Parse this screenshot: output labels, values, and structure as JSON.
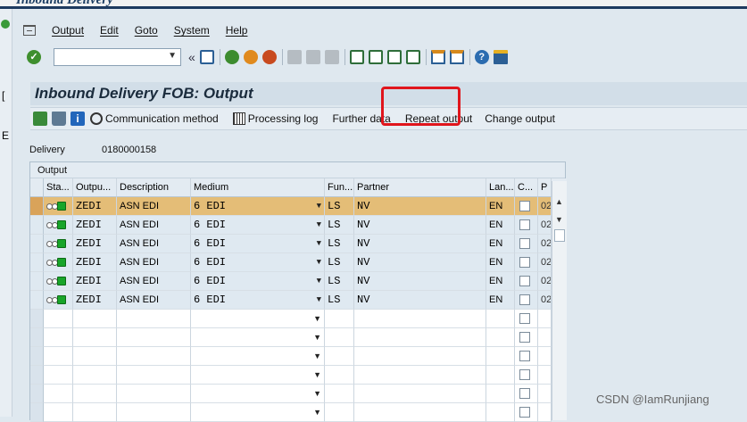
{
  "window_title_partial": "Inbound Delivery",
  "menu": {
    "items": [
      "Output",
      "Edit",
      "Goto",
      "System",
      "Help"
    ]
  },
  "toolbar": {
    "command_value": "",
    "back_symbol": "«"
  },
  "page": {
    "title": "Inbound Delivery FOB: Output"
  },
  "app_toolbar": {
    "communication_method": "Communication method",
    "processing_log": "Processing log",
    "further_data": "Further data",
    "repeat_output": "Repeat output",
    "change_output": "Change output"
  },
  "delivery": {
    "label": "Delivery",
    "value": "0180000158"
  },
  "output_table": {
    "title": "Output",
    "columns": [
      "Sta...",
      "Outpu...",
      "Description",
      "Medium",
      "Fun...",
      "Partner",
      "Lan...",
      "C...",
      "P"
    ],
    "rows": [
      {
        "output": "ZEDI",
        "description": "ASN EDI",
        "medium": "6 EDI",
        "function": "LS",
        "partner": "NV",
        "language": "EN",
        "last": "02",
        "selected": true
      },
      {
        "output": "ZEDI",
        "description": "ASN EDI",
        "medium": "6 EDI",
        "function": "LS",
        "partner": "NV",
        "language": "EN",
        "last": "02",
        "selected": false
      },
      {
        "output": "ZEDI",
        "description": "ASN EDI",
        "medium": "6 EDI",
        "function": "LS",
        "partner": "NV",
        "language": "EN",
        "last": "02",
        "selected": false
      },
      {
        "output": "ZEDI",
        "description": "ASN EDI",
        "medium": "6 EDI",
        "function": "LS",
        "partner": "NV",
        "language": "EN",
        "last": "02",
        "selected": false
      },
      {
        "output": "ZEDI",
        "description": "ASN EDI",
        "medium": "6 EDI",
        "function": "LS",
        "partner": "NV",
        "language": "EN",
        "last": "02",
        "selected": false
      },
      {
        "output": "ZEDI",
        "description": "ASN EDI",
        "medium": "6 EDI",
        "function": "LS",
        "partner": "NV",
        "language": "EN",
        "last": "02",
        "selected": false
      }
    ],
    "empty_rows": 6
  },
  "watermark": "CSDN @IamRunjiang",
  "colors": {
    "highlight_box": "#e0151c",
    "selected_row": "#e4bd77",
    "title_bar": "#1e3a5f"
  }
}
